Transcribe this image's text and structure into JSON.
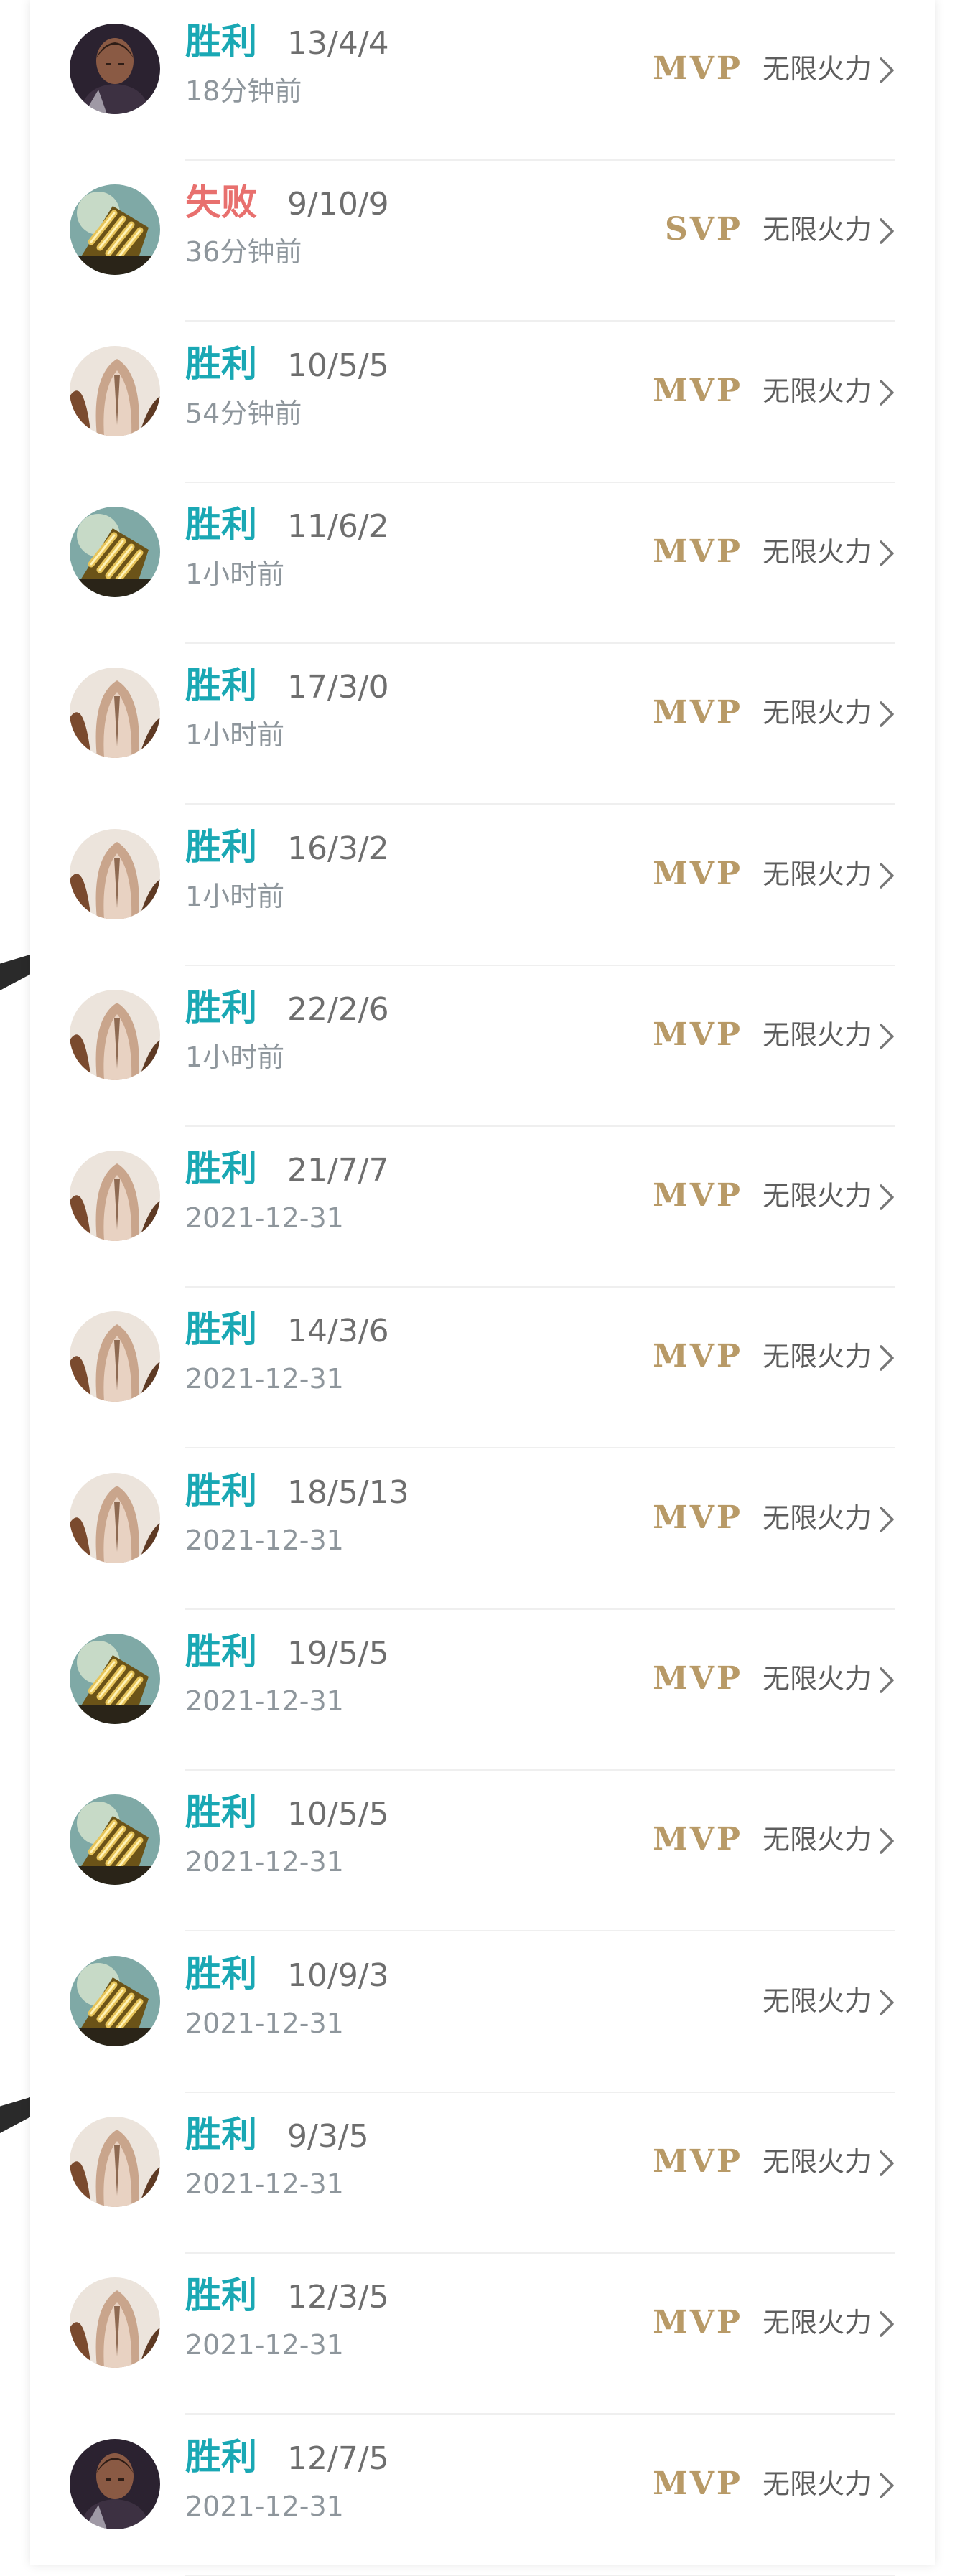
{
  "colors": {
    "win": "#1aa8b4",
    "loss": "#e8706e",
    "badge_gold": "#b89a67"
  },
  "matches": [
    {
      "result": "胜利",
      "outcome": "win",
      "kda": "13/4/4",
      "time": "18分钟前",
      "badge": "MVP",
      "mode": "无限火力",
      "hero_icon": "dark-hero-icon"
    },
    {
      "result": "失败",
      "outcome": "loss",
      "kda": "9/10/9",
      "time": "36分钟前",
      "badge": "SVP",
      "mode": "无限火力",
      "hero_icon": "golden-claw-hero-icon"
    },
    {
      "result": "胜利",
      "outcome": "win",
      "kda": "10/5/5",
      "time": "54分钟前",
      "badge": "MVP",
      "mode": "无限火力",
      "hero_icon": "masked-hero-icon"
    },
    {
      "result": "胜利",
      "outcome": "win",
      "kda": "11/6/2",
      "time": "1小时前",
      "badge": "MVP",
      "mode": "无限火力",
      "hero_icon": "golden-claw-hero-icon"
    },
    {
      "result": "胜利",
      "outcome": "win",
      "kda": "17/3/0",
      "time": "1小时前",
      "badge": "MVP",
      "mode": "无限火力",
      "hero_icon": "masked-hero-icon"
    },
    {
      "result": "胜利",
      "outcome": "win",
      "kda": "16/3/2",
      "time": "1小时前",
      "badge": "MVP",
      "mode": "无限火力",
      "hero_icon": "masked-hero-icon"
    },
    {
      "result": "胜利",
      "outcome": "win",
      "kda": "22/2/6",
      "time": "1小时前",
      "badge": "MVP",
      "mode": "无限火力",
      "hero_icon": "masked-hero-icon"
    },
    {
      "result": "胜利",
      "outcome": "win",
      "kda": "21/7/7",
      "time": "2021-12-31",
      "badge": "MVP",
      "mode": "无限火力",
      "hero_icon": "masked-hero-icon"
    },
    {
      "result": "胜利",
      "outcome": "win",
      "kda": "14/3/6",
      "time": "2021-12-31",
      "badge": "MVP",
      "mode": "无限火力",
      "hero_icon": "masked-hero-icon"
    },
    {
      "result": "胜利",
      "outcome": "win",
      "kda": "18/5/13",
      "time": "2021-12-31",
      "badge": "MVP",
      "mode": "无限火力",
      "hero_icon": "masked-hero-icon"
    },
    {
      "result": "胜利",
      "outcome": "win",
      "kda": "19/5/5",
      "time": "2021-12-31",
      "badge": "MVP",
      "mode": "无限火力",
      "hero_icon": "golden-claw-hero-icon"
    },
    {
      "result": "胜利",
      "outcome": "win",
      "kda": "10/5/5",
      "time": "2021-12-31",
      "badge": "MVP",
      "mode": "无限火力",
      "hero_icon": "golden-claw-hero-icon"
    },
    {
      "result": "胜利",
      "outcome": "win",
      "kda": "10/9/3",
      "time": "2021-12-31",
      "badge": "",
      "mode": "无限火力",
      "hero_icon": "golden-claw-hero-icon"
    },
    {
      "result": "胜利",
      "outcome": "win",
      "kda": "9/3/5",
      "time": "2021-12-31",
      "badge": "MVP",
      "mode": "无限火力",
      "hero_icon": "masked-hero-icon"
    },
    {
      "result": "胜利",
      "outcome": "win",
      "kda": "12/3/5",
      "time": "2021-12-31",
      "badge": "MVP",
      "mode": "无限火力",
      "hero_icon": "masked-hero-icon"
    },
    {
      "result": "胜利",
      "outcome": "win",
      "kda": "12/7/5",
      "time": "2021-12-31",
      "badge": "MVP",
      "mode": "无限火力",
      "hero_icon": "dark-hero-icon"
    }
  ]
}
